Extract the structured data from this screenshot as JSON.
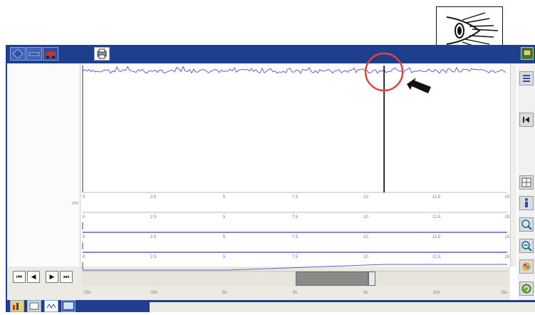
{
  "eye_callout": {
    "icon": "eye-icon"
  },
  "toolbar": {
    "buttons": [
      {
        "name": "nav-diamond-button",
        "icon": "diamond-icon"
      },
      {
        "name": "tool-button",
        "icon": "wrench-icon"
      },
      {
        "name": "car-button",
        "icon": "car-icon"
      },
      {
        "name": "print-button",
        "icon": "printer-icon"
      }
    ],
    "top_right_icon": "window-icon"
  },
  "chart": {
    "tick_labels": [
      "0",
      "2.5",
      "5",
      "7.5",
      "10",
      "12.5",
      "15"
    ],
    "row_tick_labels": [
      "0",
      "2.5",
      "5",
      "7.5",
      "10",
      "12.5",
      "15"
    ],
    "time_labels": [
      "-15s",
      "-10s",
      "-5s",
      "0s",
      "5s",
      "10s",
      "15s"
    ],
    "unit_label": "mV",
    "cursor_fraction": 0.71
  },
  "right_toolbar": {
    "buttons": [
      "list-icon",
      "skip-back-icon",
      "grid-icon",
      "info-icon",
      "zoom-in-icon",
      "zoom-out-icon",
      "color-icon",
      "refresh-icon"
    ]
  },
  "navigation": {
    "first": "⏮",
    "prev": "◀",
    "next": "▶",
    "last": "⏭"
  },
  "colors": {
    "frame_blue": "#1d3f8e",
    "trace_purple": "#6a5acd",
    "callout_red": "#e0443a"
  }
}
